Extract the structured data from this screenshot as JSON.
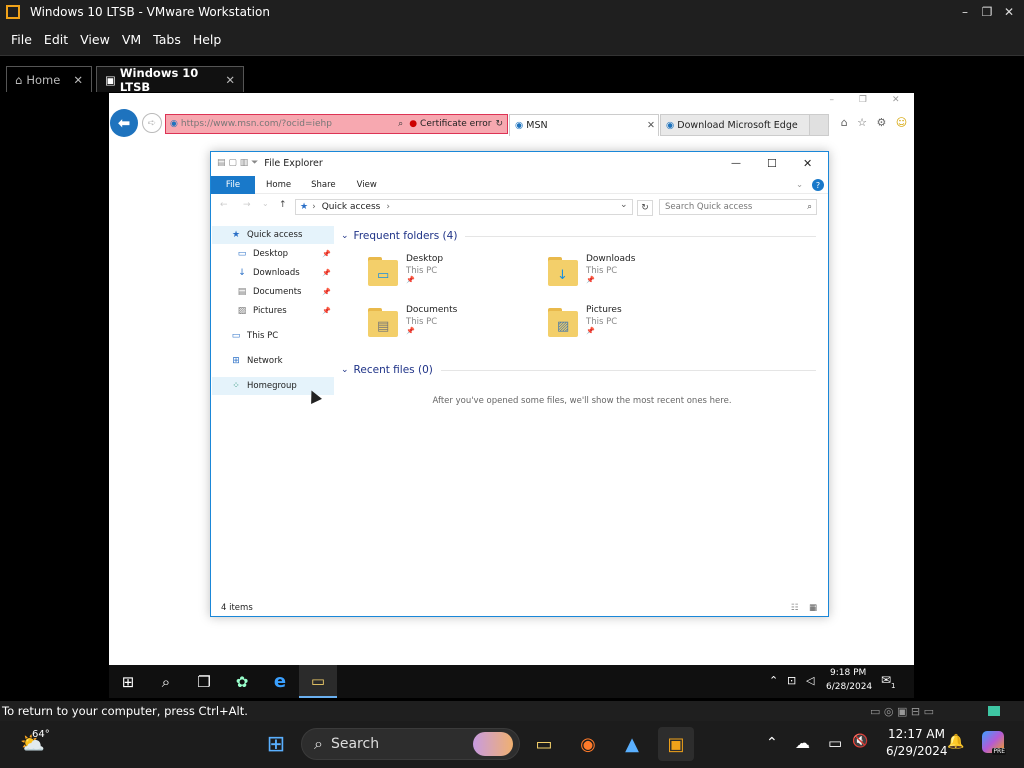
{
  "vmware": {
    "title": "Windows 10 LTSB - VMware Workstation",
    "minimize": "–",
    "maximize": "❐",
    "close": "✕",
    "menu": [
      "File",
      "Edit",
      "View",
      "VM",
      "Tabs",
      "Help"
    ],
    "tabs": [
      {
        "label": "Home",
        "icon": "⌂",
        "close": "✕"
      },
      {
        "label": "Windows 10 LTSB",
        "icon": "▣",
        "close": "✕"
      }
    ],
    "status_text": "To return to your computer, press Ctrl+Alt."
  },
  "ie": {
    "back_icon": "⬅",
    "forward_icon": "➪",
    "url": "https://www.msn.com/?ocid=iehp",
    "search_icon": "⌕",
    "cert_error": "Certificate error",
    "refresh_icon": "↻",
    "tabs": [
      {
        "label": "MSN",
        "close": "✕"
      },
      {
        "label": "Download Microsoft Edge"
      }
    ],
    "window_controls": [
      "–",
      "❐",
      "✕"
    ],
    "toolbar_icons": [
      "⌂",
      "☆",
      "⚙",
      "☺"
    ]
  },
  "explorer": {
    "title": "File Explorer",
    "minimize": "—",
    "maximize": "☐",
    "close": "✕",
    "ribbon": {
      "file": "File",
      "tabs": [
        "Home",
        "Share",
        "View"
      ],
      "help": "?",
      "expand": "⌄"
    },
    "address": {
      "back": "←",
      "forward": "→",
      "recent": "⌄",
      "up": "↑",
      "star": "★",
      "sep": "›",
      "location": "Quick access",
      "dropdown": "⌄",
      "refresh": "↻"
    },
    "search_placeholder": "Search Quick access",
    "search_icon": "⌕",
    "nav": [
      {
        "label": "Quick access",
        "icon": "★",
        "pinned": false
      },
      {
        "label": "Desktop",
        "icon": "▭",
        "pinned": true
      },
      {
        "label": "Downloads",
        "icon": "↓",
        "pinned": true
      },
      {
        "label": "Documents",
        "icon": "▤",
        "pinned": true
      },
      {
        "label": "Pictures",
        "icon": "▨",
        "pinned": true
      },
      {
        "label": "This PC",
        "icon": "▭",
        "pinned": false
      },
      {
        "label": "Network",
        "icon": "⊞",
        "pinned": false
      },
      {
        "label": "Homegroup",
        "icon": "⁘",
        "pinned": false
      }
    ],
    "pin_icon": "📌",
    "frequent_header": "Frequent folders (4)",
    "recent_header": "Recent files (0)",
    "folders": [
      {
        "name": "Desktop",
        "sub": "This PC",
        "overlay": "▭"
      },
      {
        "name": "Downloads",
        "sub": "This PC",
        "overlay": "↓"
      },
      {
        "name": "Documents",
        "sub": "This PC",
        "overlay": "▤"
      },
      {
        "name": "Pictures",
        "sub": "This PC",
        "overlay": "▨"
      }
    ],
    "chevron": "⌄",
    "empty_message": "After you've opened some files, we'll show the most recent ones here.",
    "status": "4 items",
    "view_icons": [
      "☷",
      "▦"
    ]
  },
  "guest_taskbar": {
    "icons": [
      "⊞",
      "⌕",
      "❐",
      "✿",
      "e",
      "▭"
    ],
    "tray": [
      "⌃",
      "⊡",
      "◁",
      "✉"
    ],
    "time": "9:18 PM",
    "date": "6/28/2024",
    "notification_count": "1"
  },
  "host_taskbar": {
    "weather_temp": "64°",
    "weather_icon": "⛅",
    "search_label": "Search",
    "search_icon": "⌕",
    "apps": [
      "⊞",
      "▭",
      "◉",
      "▲",
      "▣"
    ],
    "tray": [
      "⌃",
      "☁",
      "▭",
      "🔇"
    ],
    "time": "12:17 AM",
    "date": "6/29/2024",
    "bell_icon": "🔔",
    "copilot_badge": "PRE"
  }
}
